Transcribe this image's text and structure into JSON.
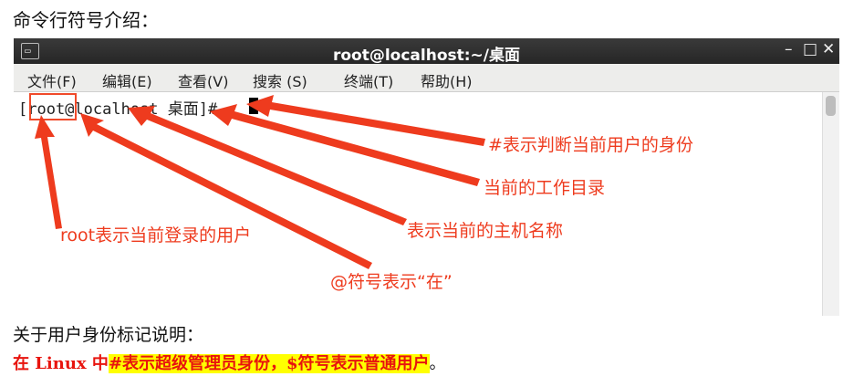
{
  "heading": "命令行符号介绍：",
  "window": {
    "title": "root@localhost:~/桌面",
    "icon_glyph": "▭",
    "controls": {
      "minimize": "–",
      "maximize": "□",
      "close": "✕"
    }
  },
  "menu": [
    "文件(F)",
    "编辑(E)",
    "查看(V)",
    "搜索 (S)",
    "终端(T)",
    "帮助(H)"
  ],
  "terminal": {
    "prompt": "[root@localhost 桌面]# "
  },
  "annotations": {
    "hash": "#表示判断当前用户的身份",
    "workdir": "当前的工作目录",
    "hostname": "表示当前的主机名称",
    "user": "root表示当前登录的用户",
    "at": "@符号表示“在”"
  },
  "notes": {
    "line1": "关于用户身份标记说明：",
    "line2_prefix": "在 Linux 中",
    "line2_highlight": "#表示超级管理员身份，$符号表示普通用户",
    "line2_suffix": "。"
  },
  "colors": {
    "annotation": "#ee3b1e",
    "highlight": "#ffff00",
    "note_red": "#e8140e"
  }
}
